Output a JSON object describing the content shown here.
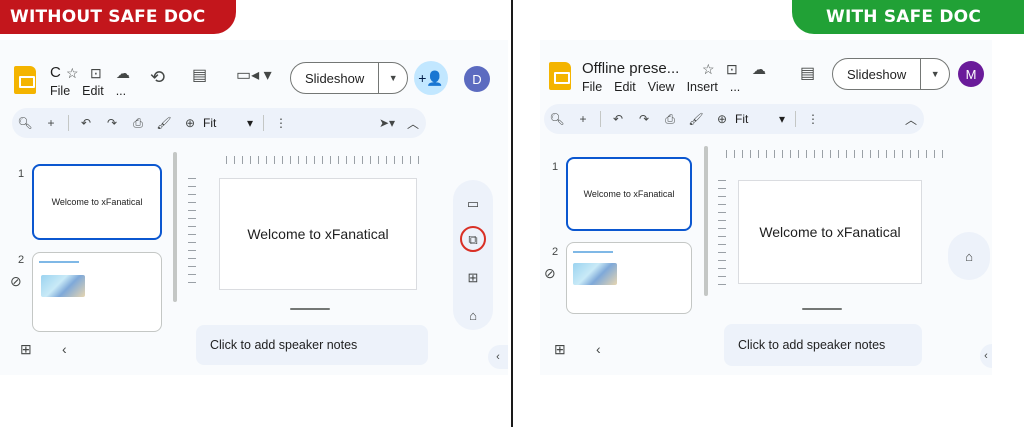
{
  "banners": {
    "without": "WITHOUT SAFE DOC",
    "with": "WITH SAFE DOC"
  },
  "colors": {
    "without_banner": "#c3161c",
    "with_banner": "#21a136",
    "accent": "#0b57d0",
    "highlight_ring": "#d93025"
  },
  "left": {
    "title": "C",
    "menu": [
      "File",
      "Edit",
      "..."
    ],
    "slideshow_label": "Slideshow",
    "avatar": "D",
    "avatar_color": "#5c6bc0",
    "toolbar_zoom": "Fit",
    "slides": [
      {
        "number": "1",
        "title": "Welcome to xFanatical"
      },
      {
        "number": "2",
        "title": ""
      }
    ],
    "canvas_text": "Welcome to xFanatical",
    "notes_placeholder": "Click to add speaker notes"
  },
  "right": {
    "title": "Offline prese...",
    "menu": [
      "File",
      "Edit",
      "View",
      "Insert",
      "..."
    ],
    "slideshow_label": "Slideshow",
    "avatar": "M",
    "avatar_color": "#6a1b9a",
    "toolbar_zoom": "Fit",
    "slides": [
      {
        "number": "1",
        "title": "Welcome to xFanatical"
      },
      {
        "number": "2",
        "title": ""
      }
    ],
    "canvas_text": "Welcome to xFanatical",
    "notes_placeholder": "Click to add speaker notes"
  },
  "icons": {
    "star": "star-icon",
    "folder": "folder-move-icon",
    "cloud": "cloud-offline-icon",
    "history": "history-icon",
    "comment": "comment-icon",
    "meet": "video-icon",
    "share": "add-person-icon",
    "search": "search-icon",
    "add": "plus-icon",
    "undo": "undo-icon",
    "redo": "redo-icon",
    "print": "print-icon",
    "paint": "paint-format-icon",
    "zoom": "zoom-icon",
    "more": "more-vert-icon",
    "select": "select-pointer-icon",
    "chevron_up": "chevron-up-icon",
    "grid": "grid-view-icon",
    "back": "chevron-left-icon",
    "caption": "caption-icon",
    "safe_doc": "safe-doc-icon",
    "contacts": "contacts-icon",
    "drive_folder": "folder-icon",
    "link": "link-icon"
  }
}
